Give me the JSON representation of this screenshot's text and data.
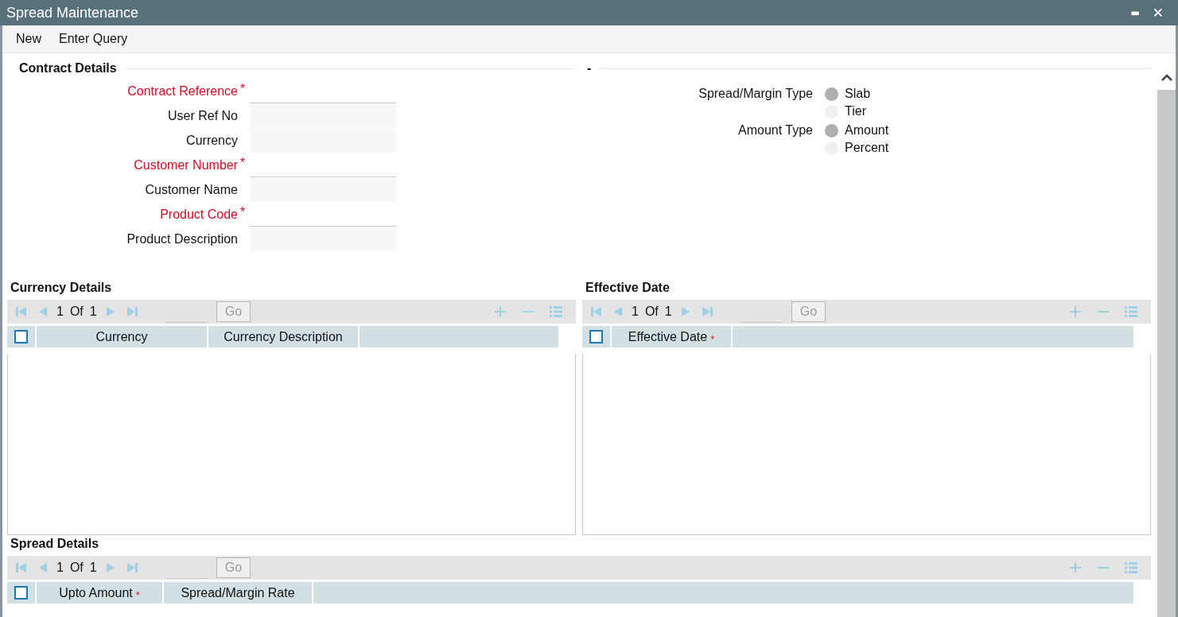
{
  "window": {
    "title": "Spread Maintenance",
    "minimize": "▬",
    "close": "✕"
  },
  "toolbar": [
    {
      "label": "New"
    },
    {
      "label": "Enter Query"
    }
  ],
  "contract_details": {
    "title": "Contract Details",
    "fields": [
      {
        "label": "Contract Reference",
        "required": true,
        "mark": "*"
      },
      {
        "label": "User Ref No",
        "required": false
      },
      {
        "label": "Currency",
        "required": false
      },
      {
        "label": "Customer Number",
        "required": true,
        "mark": "*"
      },
      {
        "label": "Customer Name",
        "required": false
      },
      {
        "label": "Product Code",
        "required": true,
        "mark": "*"
      },
      {
        "label": "Product Description",
        "required": false
      }
    ]
  },
  "options_section": {
    "title": "-",
    "groups": [
      {
        "label": "Spread/Margin Type",
        "options": [
          {
            "label": "Slab",
            "selected": true
          },
          {
            "label": "Tier",
            "selected": false
          }
        ]
      },
      {
        "label": "Amount Type",
        "options": [
          {
            "label": "Amount",
            "selected": true
          },
          {
            "label": "Percent",
            "selected": false
          }
        ]
      }
    ]
  },
  "currency_details": {
    "title": "Currency Details",
    "page": "1",
    "of": "Of",
    "pages": "1",
    "go": "Go",
    "select_all_checked": false,
    "columns": [
      {
        "label": "Currency"
      },
      {
        "label": "Currency Description"
      }
    ]
  },
  "effective_date": {
    "title": "Effective Date",
    "page": "1",
    "of": "Of",
    "pages": "1",
    "go": "Go",
    "select_all_checked": false,
    "columns": [
      {
        "label": "Effective Date",
        "mark": "*"
      }
    ]
  },
  "spread_details": {
    "title": "Spread Details",
    "page": "1",
    "of": "Of",
    "pages": "1",
    "go": "Go",
    "select_all_checked": false,
    "columns": [
      {
        "label": "Upto Amount",
        "mark": "*"
      },
      {
        "label": "Spread/Margin Rate"
      }
    ]
  }
}
